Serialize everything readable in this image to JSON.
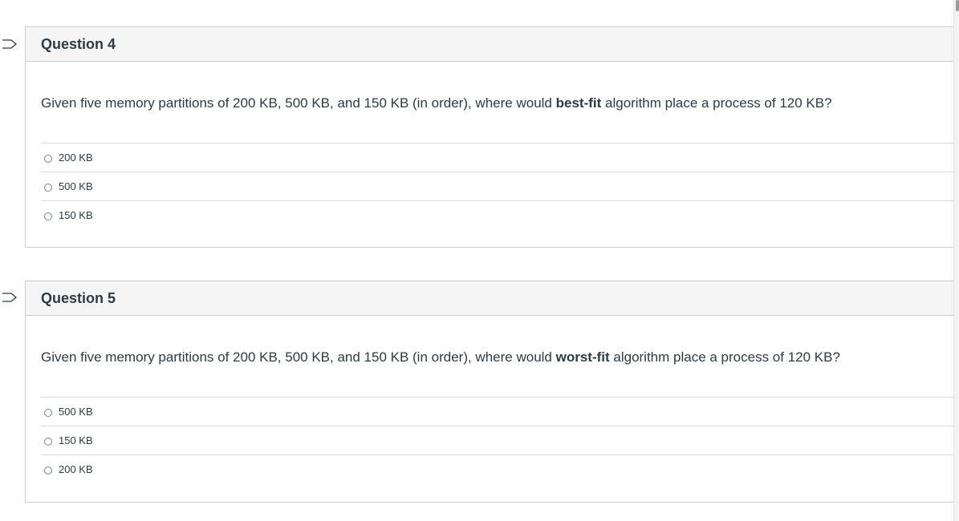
{
  "questions": [
    {
      "title": "Question 4",
      "text_before": "Given five memory partitions of 200 KB, 500 KB, and 150 KB (in order), where would ",
      "text_bold": "best-fit",
      "text_after": " algorithm place a process of 120 KB?",
      "answers": [
        "200 KB",
        "500 KB",
        "150 KB"
      ]
    },
    {
      "title": "Question 5",
      "text_before": "Given five memory partitions of 200 KB, 500 KB, and 150 KB (in order), where would ",
      "text_bold": "worst-fit",
      "text_after": " algorithm place a process of 120 KB?",
      "answers": [
        "500 KB",
        "150 KB",
        "200 KB"
      ]
    }
  ],
  "icons": {
    "flag": "flag-question-icon"
  }
}
